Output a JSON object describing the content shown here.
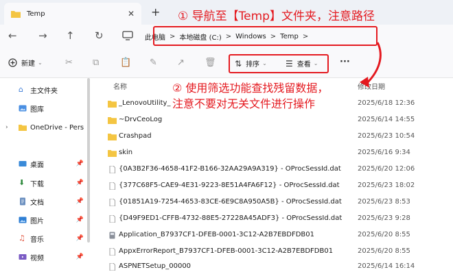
{
  "tab": {
    "title": "Temp",
    "close": "✕",
    "new": "+"
  },
  "nav": {
    "back": "←",
    "forward": "→",
    "up": "↑",
    "refresh": "↻"
  },
  "breadcrumb": {
    "items": [
      "此电脑",
      "本地磁盘 (C:)",
      "Windows",
      "Temp"
    ],
    "separator": ">"
  },
  "toolbar": {
    "new_label": "新建",
    "sort_label": "排序",
    "view_label": "查看",
    "more": "···"
  },
  "sidebar": {
    "items": [
      {
        "label": "主文件夹",
        "icon": "home-icon",
        "pinned": false
      },
      {
        "label": "图库",
        "icon": "gallery-icon",
        "pinned": false
      },
      {
        "label": "OneDrive - Pers",
        "icon": "cloud-folder-icon",
        "pinned": false
      },
      {
        "label": "桌面",
        "icon": "desktop-icon",
        "pinned": true
      },
      {
        "label": "下载",
        "icon": "download-icon",
        "pinned": true
      },
      {
        "label": "文档",
        "icon": "documents-icon",
        "pinned": true
      },
      {
        "label": "图片",
        "icon": "pictures-icon",
        "pinned": true
      },
      {
        "label": "音乐",
        "icon": "music-icon",
        "pinned": true
      },
      {
        "label": "视频",
        "icon": "videos-icon",
        "pinned": true
      }
    ]
  },
  "columns": {
    "name": "名称",
    "date": "修改日期"
  },
  "files": [
    {
      "name": "_LenovoUtility_",
      "date": "2025/6/18 12:36",
      "type": "folder"
    },
    {
      "name": "~DrvCeoLog",
      "date": "2025/6/14 14:55",
      "type": "folder"
    },
    {
      "name": "Crashpad",
      "date": "2025/6/23 10:54",
      "type": "folder"
    },
    {
      "name": "skin",
      "date": "2025/6/16 9:34",
      "type": "folder"
    },
    {
      "name": "{0A3B2F36-4658-41F2-B166-32AA29A9A319} - OProcSessId.dat",
      "date": "2025/6/20 12:06",
      "type": "file"
    },
    {
      "name": "{377C68F5-CAE9-4E31-9223-8E51A4FA6F12} - OProcSessId.dat",
      "date": "2025/6/23 18:02",
      "type": "file"
    },
    {
      "name": "{01851A19-7254-4653-83CE-6E9C8A950A5B} - OProcSessId.dat",
      "date": "2025/6/23 8:53",
      "type": "file"
    },
    {
      "name": "{D49F9ED1-CFFB-4732-88E5-27228A45ADF3} - OProcSessId.dat",
      "date": "2025/6/23 9:28",
      "type": "file"
    },
    {
      "name": "Application_B7937CF1-DFEB-0001-3C12-A2B7EBDFDB01",
      "date": "2025/6/20 8:55",
      "type": "app"
    },
    {
      "name": "AppxErrorReport_B7937CF1-DFEB-0001-3C12-A2B7EBDFDB01",
      "date": "2025/6/20 8:55",
      "type": "file"
    },
    {
      "name": "ASPNETSetup_00000",
      "date": "2025/6/14 16:14",
      "type": "file"
    }
  ],
  "annotations": {
    "step1": "① 导航至【Temp】文件夹，注意路径",
    "step2_line1": "② 使用筛选功能查找残留数据，",
    "step2_line2": "注意不要对无关文件进行操作"
  },
  "colors": {
    "accent_red": "#e4191f",
    "folder_yellow": "#f4c542"
  }
}
